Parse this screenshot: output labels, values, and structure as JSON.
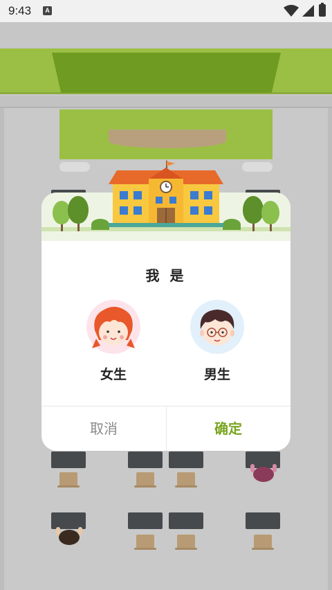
{
  "status_bar": {
    "time": "9:43",
    "notification_icon": "A",
    "icons": [
      "wifi-icon",
      "signal-icon",
      "battery-icon"
    ]
  },
  "dialog": {
    "title": "我 是",
    "choices": [
      {
        "label": "女生",
        "avatar": "girl-avatar-icon"
      },
      {
        "label": "男生",
        "avatar": "boy-avatar-icon"
      }
    ],
    "cancel_label": "取消",
    "confirm_label": "确定"
  },
  "colors": {
    "accent": "#7aa51f",
    "stage_green": "#9bbf44",
    "cancel_text": "#8a8a8a"
  }
}
